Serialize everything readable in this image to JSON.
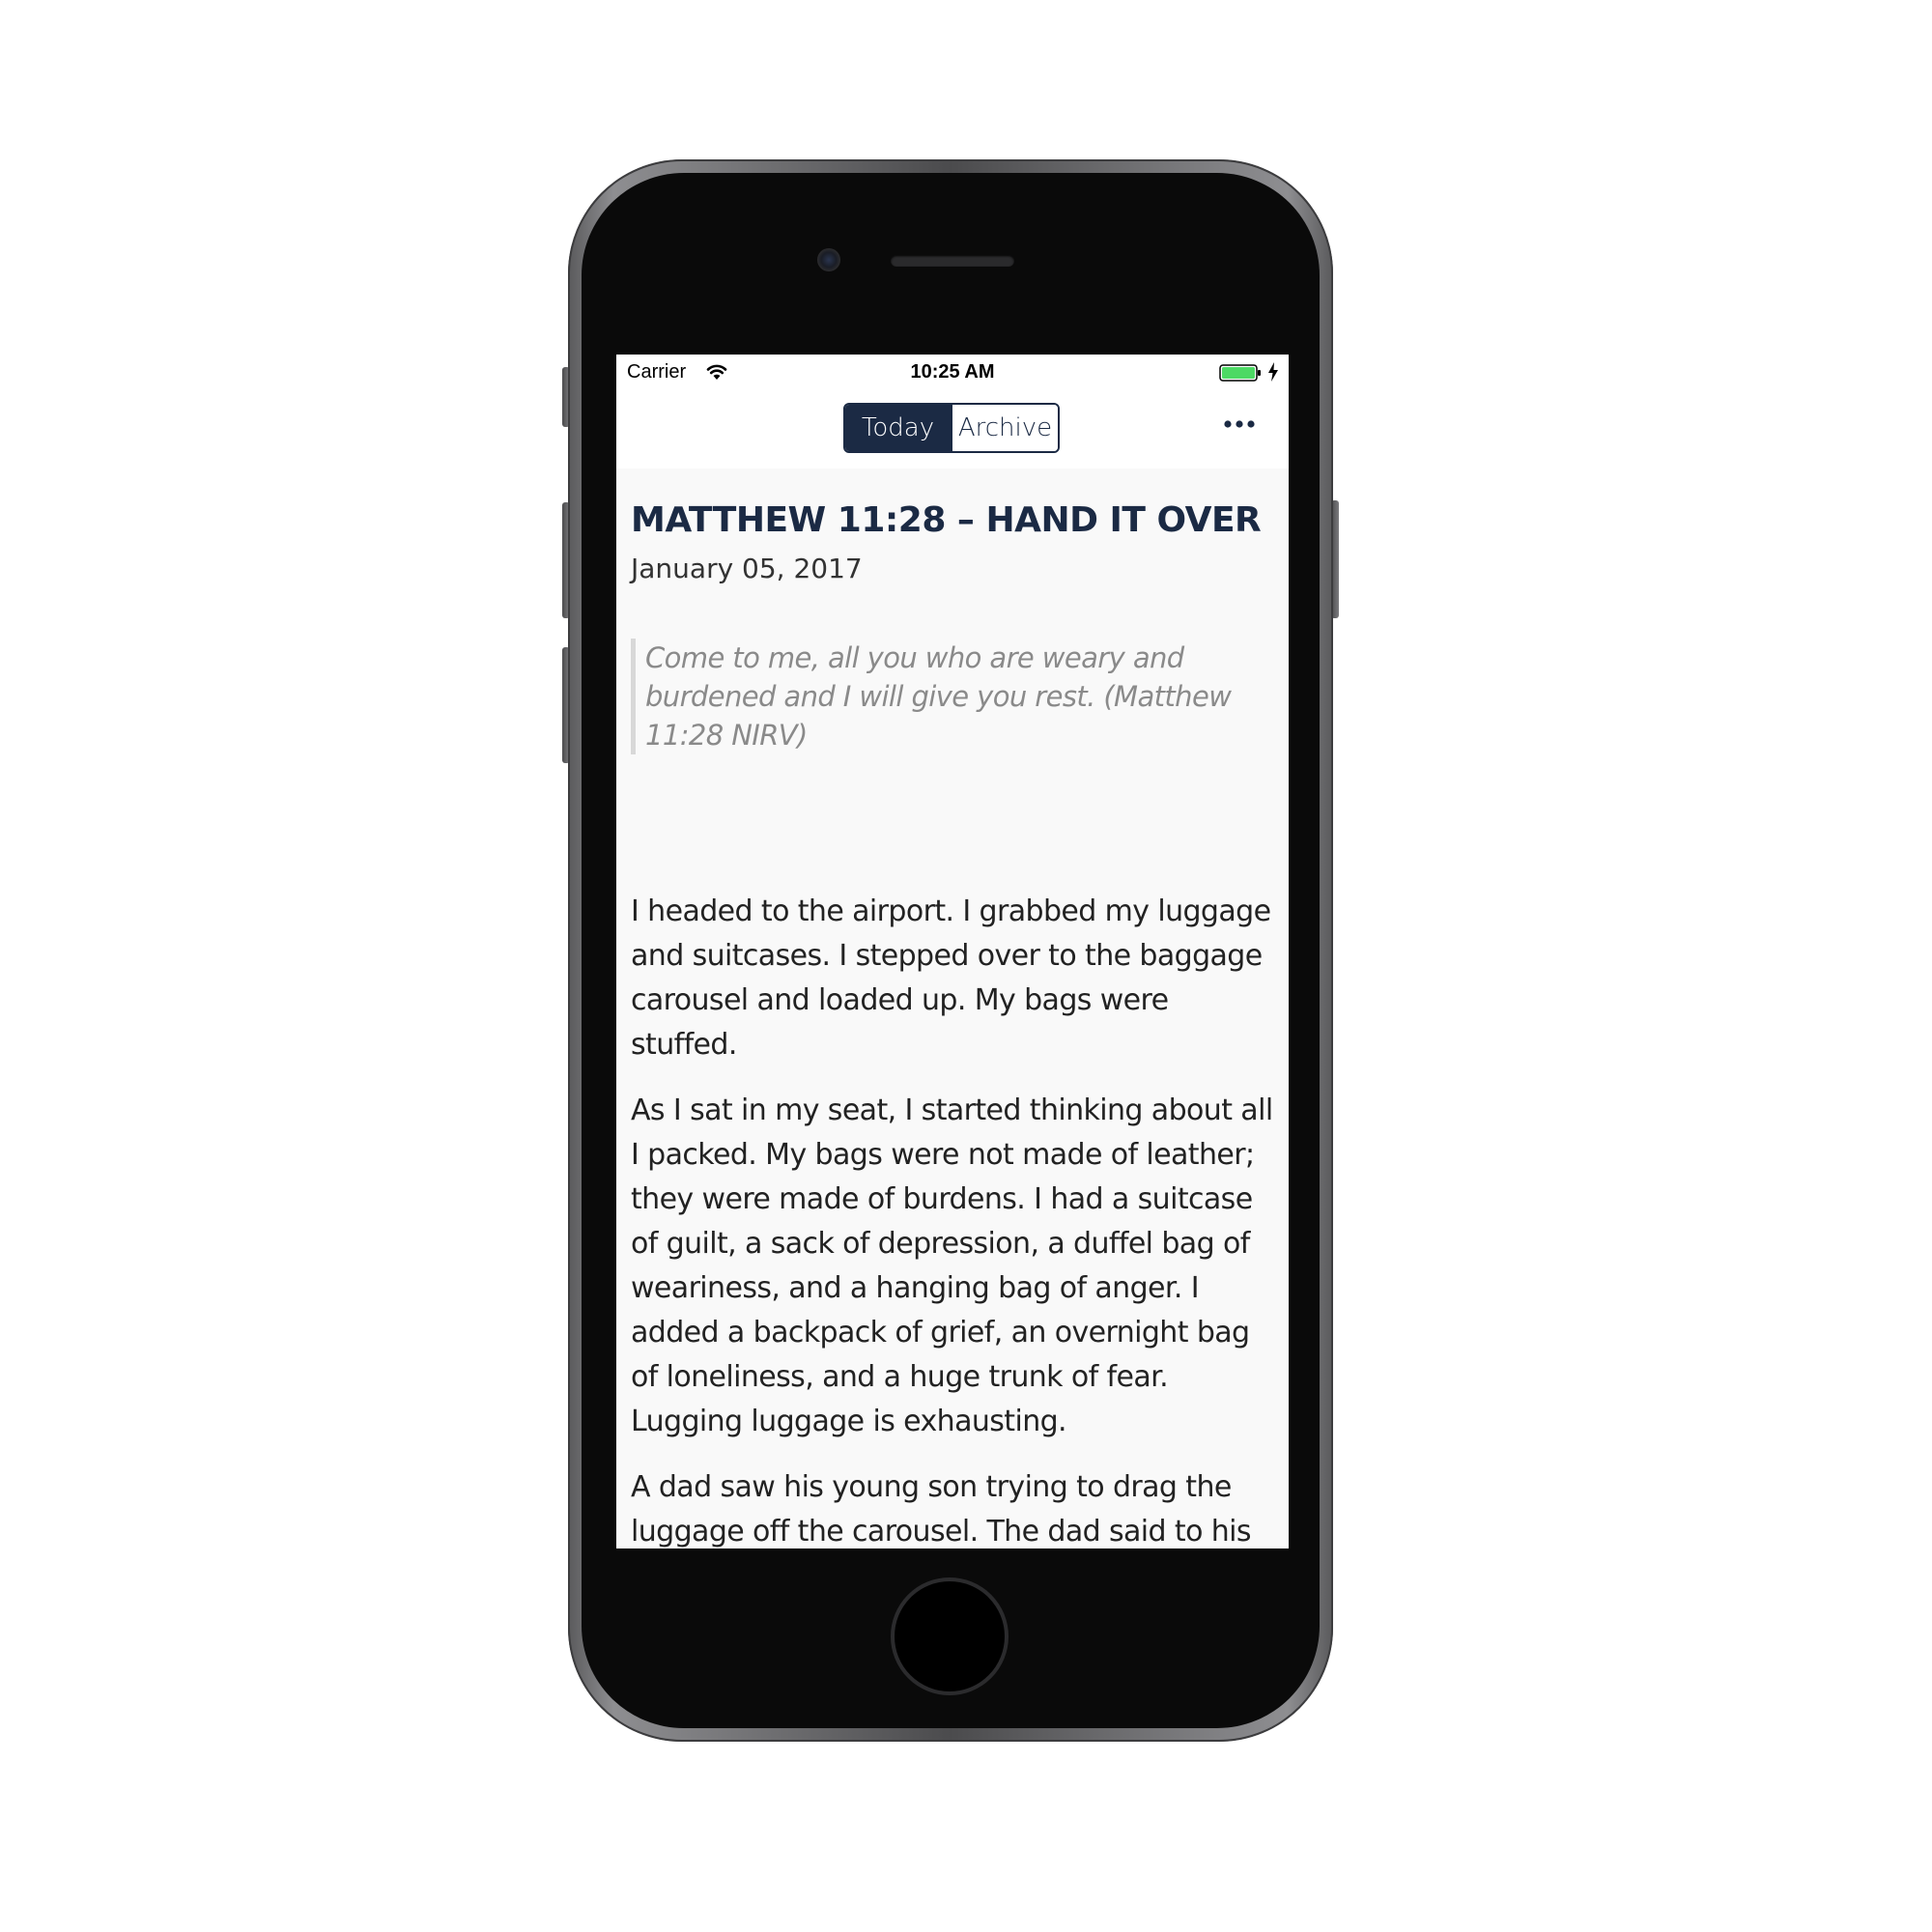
{
  "status_bar": {
    "carrier": "Carrier",
    "time": "10:25 AM",
    "battery_color": "#4cd964"
  },
  "nav": {
    "tabs": [
      {
        "label": "Today",
        "selected": true
      },
      {
        "label": "Archive",
        "selected": false
      }
    ],
    "more_icon": "ellipsis-icon",
    "accent_color": "#1b2a44"
  },
  "devotional": {
    "title": "MATTHEW 11:28 – HAND IT OVER",
    "date": "January 05, 2017",
    "verse": "Come to me, all you who are weary and burdened and I will give you rest. (Matthew 11:28 NIRV)",
    "paragraphs": [
      "I headed to the airport. I grabbed my luggage and suitcases. I stepped over to the baggage carousel and loaded up. My bags were stuffed.",
      "As I sat in my seat, I started thinking about all I packed. My bags were not made of leather; they were made of burdens. I had a suitcase of guilt, a sack of depression, a duffel bag of weariness, and a hanging bag of anger. I added a backpack of grief, an overnight bag of loneliness, and a huge trunk of fear. Lugging luggage is exhausting.",
      "A dad saw his young son trying to drag the luggage off the carousel. The dad said to his son, “Set it down. I got this.” God is saying to you, “Set it down, child. I’ll carry the baggage"
    ]
  }
}
